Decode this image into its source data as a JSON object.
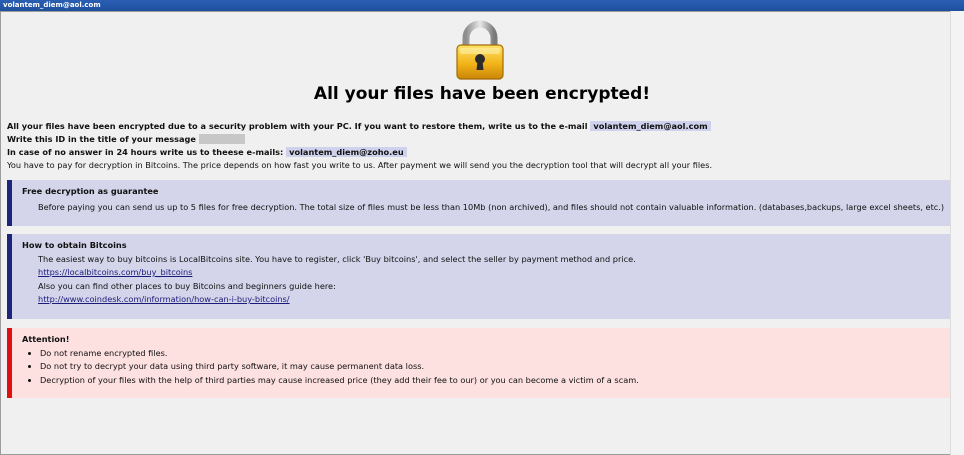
{
  "window": {
    "title": "volantem_diem@aol.com"
  },
  "header": {
    "icon": "padlock-icon",
    "headline": "All your files have been encrypted!"
  },
  "intro": {
    "line1_text": "All your files have been encrypted due to a security problem with your PC. If you want to restore them, write us to the e-mail",
    "line1_email": "volantem_diem@aol.com",
    "line2_text": "Write this ID in the title of your message",
    "line3_text": "In case of no answer in 24 hours write us to theese e-mails:",
    "line3_email": "volantem_diem@zoho.eu",
    "line4_text": "You have to pay for decryption in Bitcoins. The price depends on how fast you write to us. After payment we will send you the decryption tool that will decrypt all your files."
  },
  "free_box": {
    "heading": "Free decryption as guarantee",
    "body": "Before paying you can send us up to 5 files for free decryption. The total size of files must be less than 10Mb (non archived), and files should not contain valuable information. (databases,backups, large excel sheets, etc.)"
  },
  "bitcoin_box": {
    "heading": "How to obtain Bitcoins",
    "line1": "The easiest way to buy bitcoins is LocalBitcoins site. You have to register, click 'Buy bitcoins', and select the seller by payment method and price.",
    "link1": "https://localbitcoins.com/buy_bitcoins",
    "line2": "Also you can find other places to buy Bitcoins and beginners guide here:",
    "link2": "http://www.coindesk.com/information/how-can-i-buy-bitcoins/"
  },
  "attention_box": {
    "heading": "Attention!",
    "items": [
      "Do not rename encrypted files.",
      "Do not try to decrypt your data using third party software, it may cause permanent data loss.",
      "Decryption of your files with the help of third parties may cause increased price (they add their fee to our) or you can become a victim of a scam."
    ]
  },
  "colors": {
    "blue_box_bg": "#d4d4ea",
    "blue_box_border": "#1d257a",
    "red_box_bg": "#fde0e0",
    "red_box_border": "#e01010",
    "email_highlight": "#cfd2ec"
  }
}
